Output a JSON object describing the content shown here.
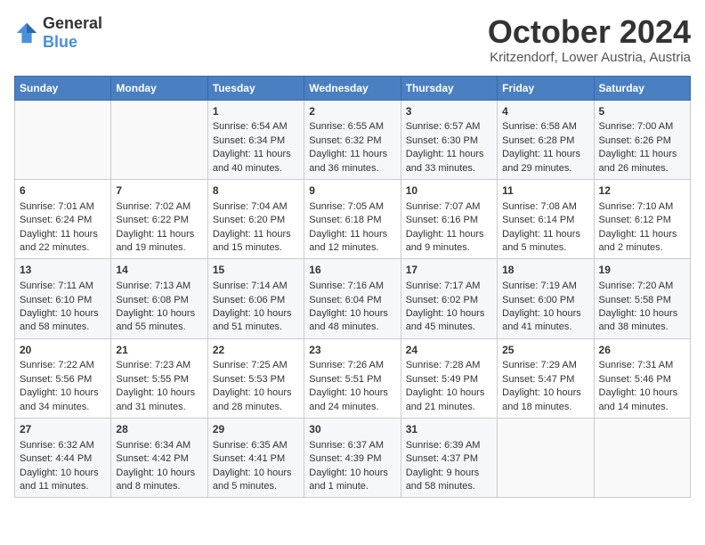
{
  "header": {
    "logo_general": "General",
    "logo_blue": "Blue",
    "month_title": "October 2024",
    "location": "Kritzendorf, Lower Austria, Austria"
  },
  "weekdays": [
    "Sunday",
    "Monday",
    "Tuesday",
    "Wednesday",
    "Thursday",
    "Friday",
    "Saturday"
  ],
  "weeks": [
    [
      {
        "day": "",
        "content": ""
      },
      {
        "day": "",
        "content": ""
      },
      {
        "day": "1",
        "content": "Sunrise: 6:54 AM\nSunset: 6:34 PM\nDaylight: 11 hours and 40 minutes."
      },
      {
        "day": "2",
        "content": "Sunrise: 6:55 AM\nSunset: 6:32 PM\nDaylight: 11 hours and 36 minutes."
      },
      {
        "day": "3",
        "content": "Sunrise: 6:57 AM\nSunset: 6:30 PM\nDaylight: 11 hours and 33 minutes."
      },
      {
        "day": "4",
        "content": "Sunrise: 6:58 AM\nSunset: 6:28 PM\nDaylight: 11 hours and 29 minutes."
      },
      {
        "day": "5",
        "content": "Sunrise: 7:00 AM\nSunset: 6:26 PM\nDaylight: 11 hours and 26 minutes."
      }
    ],
    [
      {
        "day": "6",
        "content": "Sunrise: 7:01 AM\nSunset: 6:24 PM\nDaylight: 11 hours and 22 minutes."
      },
      {
        "day": "7",
        "content": "Sunrise: 7:02 AM\nSunset: 6:22 PM\nDaylight: 11 hours and 19 minutes."
      },
      {
        "day": "8",
        "content": "Sunrise: 7:04 AM\nSunset: 6:20 PM\nDaylight: 11 hours and 15 minutes."
      },
      {
        "day": "9",
        "content": "Sunrise: 7:05 AM\nSunset: 6:18 PM\nDaylight: 11 hours and 12 minutes."
      },
      {
        "day": "10",
        "content": "Sunrise: 7:07 AM\nSunset: 6:16 PM\nDaylight: 11 hours and 9 minutes."
      },
      {
        "day": "11",
        "content": "Sunrise: 7:08 AM\nSunset: 6:14 PM\nDaylight: 11 hours and 5 minutes."
      },
      {
        "day": "12",
        "content": "Sunrise: 7:10 AM\nSunset: 6:12 PM\nDaylight: 11 hours and 2 minutes."
      }
    ],
    [
      {
        "day": "13",
        "content": "Sunrise: 7:11 AM\nSunset: 6:10 PM\nDaylight: 10 hours and 58 minutes."
      },
      {
        "day": "14",
        "content": "Sunrise: 7:13 AM\nSunset: 6:08 PM\nDaylight: 10 hours and 55 minutes."
      },
      {
        "day": "15",
        "content": "Sunrise: 7:14 AM\nSunset: 6:06 PM\nDaylight: 10 hours and 51 minutes."
      },
      {
        "day": "16",
        "content": "Sunrise: 7:16 AM\nSunset: 6:04 PM\nDaylight: 10 hours and 48 minutes."
      },
      {
        "day": "17",
        "content": "Sunrise: 7:17 AM\nSunset: 6:02 PM\nDaylight: 10 hours and 45 minutes."
      },
      {
        "day": "18",
        "content": "Sunrise: 7:19 AM\nSunset: 6:00 PM\nDaylight: 10 hours and 41 minutes."
      },
      {
        "day": "19",
        "content": "Sunrise: 7:20 AM\nSunset: 5:58 PM\nDaylight: 10 hours and 38 minutes."
      }
    ],
    [
      {
        "day": "20",
        "content": "Sunrise: 7:22 AM\nSunset: 5:56 PM\nDaylight: 10 hours and 34 minutes."
      },
      {
        "day": "21",
        "content": "Sunrise: 7:23 AM\nSunset: 5:55 PM\nDaylight: 10 hours and 31 minutes."
      },
      {
        "day": "22",
        "content": "Sunrise: 7:25 AM\nSunset: 5:53 PM\nDaylight: 10 hours and 28 minutes."
      },
      {
        "day": "23",
        "content": "Sunrise: 7:26 AM\nSunset: 5:51 PM\nDaylight: 10 hours and 24 minutes."
      },
      {
        "day": "24",
        "content": "Sunrise: 7:28 AM\nSunset: 5:49 PM\nDaylight: 10 hours and 21 minutes."
      },
      {
        "day": "25",
        "content": "Sunrise: 7:29 AM\nSunset: 5:47 PM\nDaylight: 10 hours and 18 minutes."
      },
      {
        "day": "26",
        "content": "Sunrise: 7:31 AM\nSunset: 5:46 PM\nDaylight: 10 hours and 14 minutes."
      }
    ],
    [
      {
        "day": "27",
        "content": "Sunrise: 6:32 AM\nSunset: 4:44 PM\nDaylight: 10 hours and 11 minutes."
      },
      {
        "day": "28",
        "content": "Sunrise: 6:34 AM\nSunset: 4:42 PM\nDaylight: 10 hours and 8 minutes."
      },
      {
        "day": "29",
        "content": "Sunrise: 6:35 AM\nSunset: 4:41 PM\nDaylight: 10 hours and 5 minutes."
      },
      {
        "day": "30",
        "content": "Sunrise: 6:37 AM\nSunset: 4:39 PM\nDaylight: 10 hours and 1 minute."
      },
      {
        "day": "31",
        "content": "Sunrise: 6:39 AM\nSunset: 4:37 PM\nDaylight: 9 hours and 58 minutes."
      },
      {
        "day": "",
        "content": ""
      },
      {
        "day": "",
        "content": ""
      }
    ]
  ]
}
